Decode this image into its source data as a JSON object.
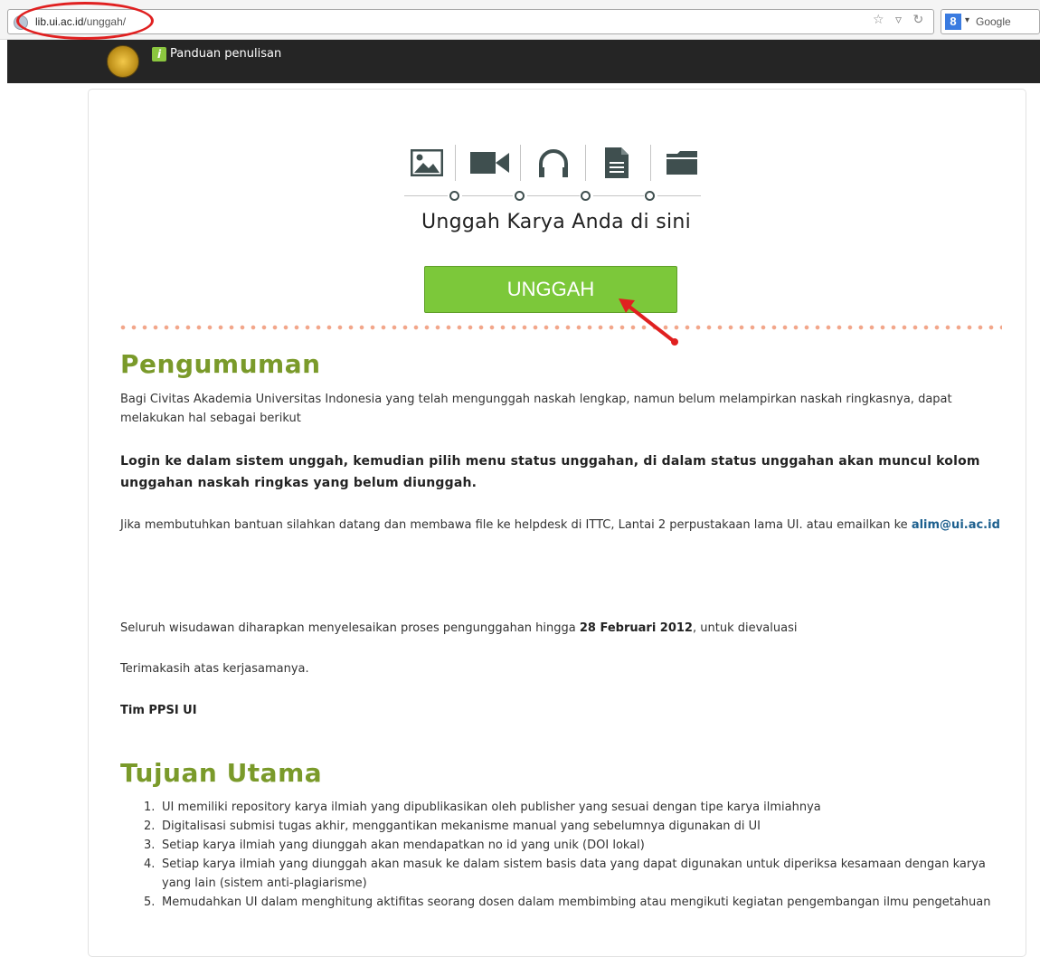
{
  "browser": {
    "url_host": "lib.ui.ac.id",
    "url_path": "/unggah/",
    "search_engine": "Google",
    "search_badge": "8"
  },
  "topbar": {
    "guide_icon": "i",
    "guide_label": "Panduan penulisan"
  },
  "hero": {
    "media_icons": [
      "image-icon",
      "video-icon",
      "audio-icon",
      "document-icon",
      "folder-icon"
    ],
    "title": "Unggah Karya Anda di sini",
    "upload_button": "UNGGAH"
  },
  "announcement": {
    "heading": "Pengumuman",
    "para1": "Bagi Civitas Akademia Universitas Indonesia yang telah mengunggah naskah lengkap, namun belum melampirkan naskah ringkasnya, dapat melakukan hal sebagai berikut",
    "para2": "Login ke dalam sistem unggah, kemudian pilih menu status unggahan, di dalam status unggahan akan muncul kolom unggahan naskah ringkas yang belum diunggah.",
    "para3_prefix": "Jika membutuhkan bantuan silahkan datang dan membawa file ke helpdesk di ITTC, Lantai 2 perpustakaan lama UI. atau emailkan ke ",
    "para3_email": "alim@ui.ac.id",
    "para4_prefix": "Seluruh wisudawan diharapkan menyelesaikan proses pengunggahan hingga ",
    "para4_date": "28 Februari 2012",
    "para4_suffix": ", untuk dievaluasi",
    "para5": "Terimakasih atas kerjasamanya.",
    "signature": "Tim PPSI UI"
  },
  "goals": {
    "heading": "Tujuan Utama",
    "items": [
      {
        "num": "1.",
        "text": "UI memiliki repository karya ilmiah yang dipublikasikan oleh publisher yang sesuai dengan tipe karya ilmiahnya"
      },
      {
        "num": "2.",
        "text": "Digitalisasi submisi tugas akhir, menggantikan mekanisme manual yang sebelumnya digunakan di UI"
      },
      {
        "num": "3.",
        "text": "Setiap karya ilmiah yang diunggah akan mendapatkan no id yang unik (DOI lokal)"
      },
      {
        "num": "4.",
        "text": "Setiap karya ilmiah yang diunggah akan masuk ke dalam sistem basis data yang dapat digunakan untuk diperiksa kesamaan dengan karya yang lain (sistem anti-plagiarisme)"
      },
      {
        "num": "5.",
        "text": "Memudahkan UI dalam menghitung aktifitas seorang dosen dalam membimbing atau mengikuti kegiatan pengembangan ilmu pengetahuan"
      }
    ]
  },
  "colors": {
    "accent_green": "#7cc83a",
    "heading_green": "#7a9a2a",
    "dots": "#f2a68a",
    "annotation_red": "#e02020"
  }
}
